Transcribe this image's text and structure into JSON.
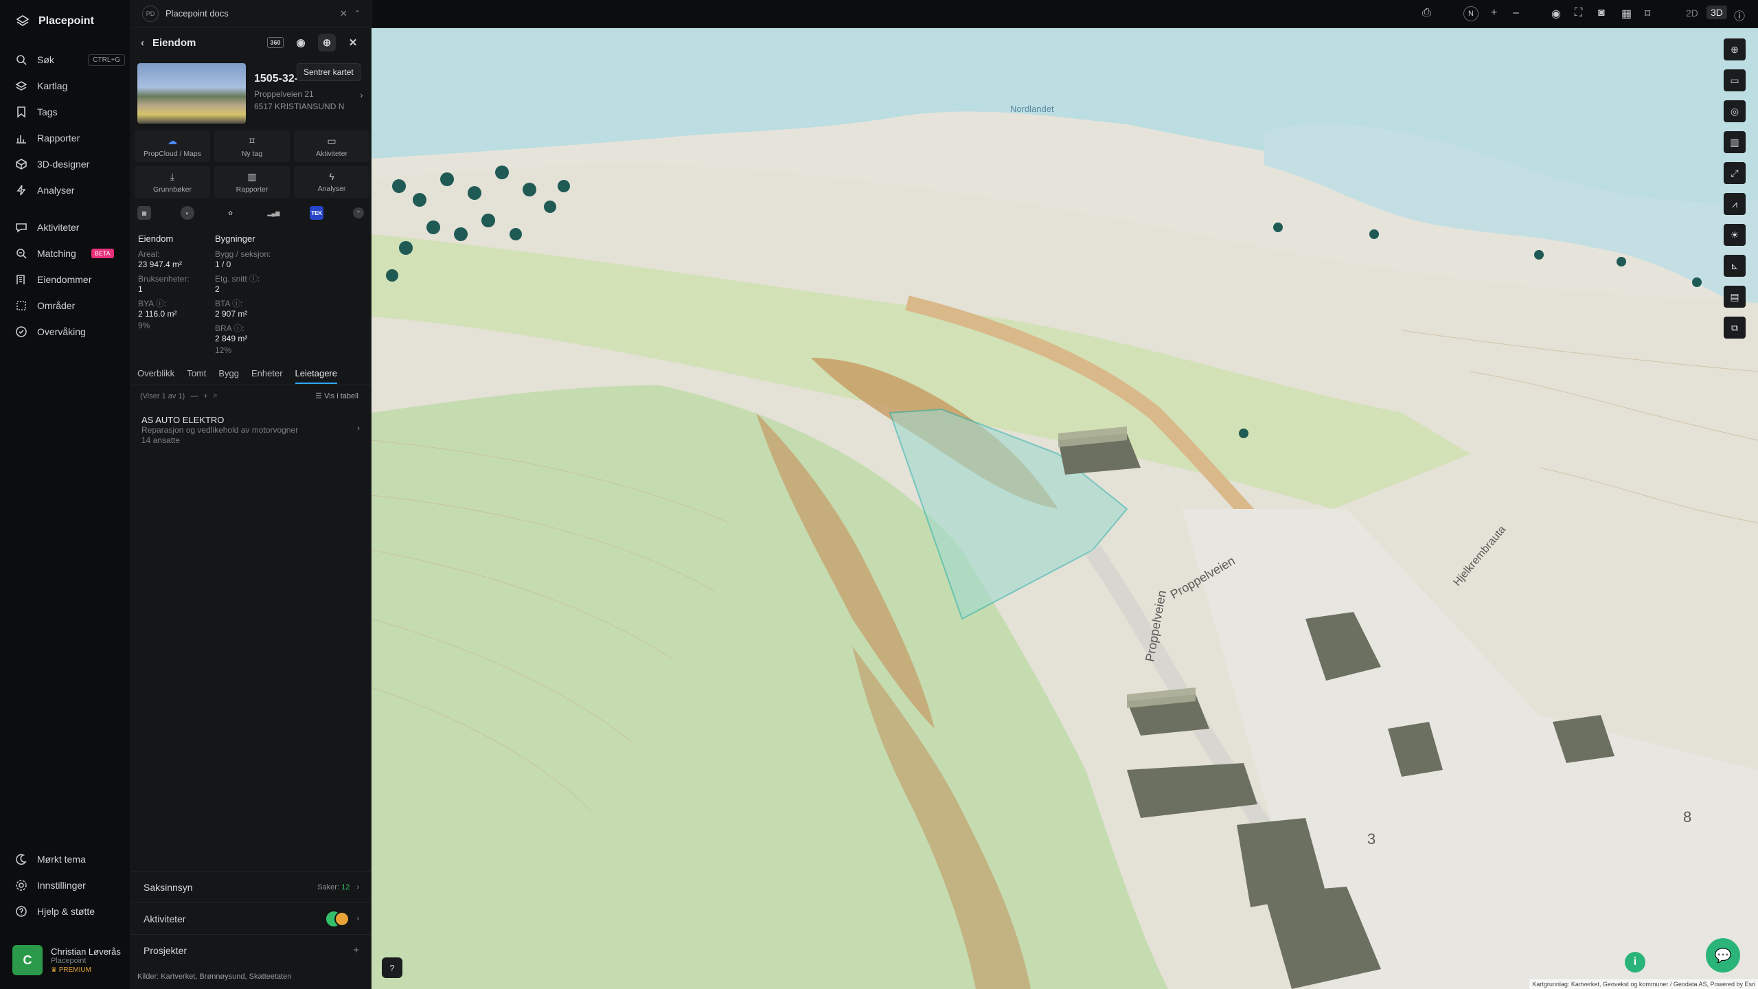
{
  "app": {
    "name": "Placepoint"
  },
  "nav": {
    "items": [
      {
        "label": "Søk",
        "shortcut": "CTRL+G"
      },
      {
        "label": "Kartlag"
      },
      {
        "label": "Tags"
      },
      {
        "label": "Rapporter"
      },
      {
        "label": "3D-designer"
      },
      {
        "label": "Analyser"
      },
      {
        "label": "Aktiviteter"
      },
      {
        "label": "Matching",
        "badge": "BETA"
      },
      {
        "label": "Eiendommer"
      },
      {
        "label": "Områder"
      },
      {
        "label": "Overvåking"
      }
    ],
    "bottom": [
      {
        "label": "Mørkt tema"
      },
      {
        "label": "Innstillinger"
      },
      {
        "label": "Hjelp & støtte"
      }
    ],
    "user": {
      "initial": "C",
      "name": "Christian Løverås",
      "org": "Placepoint",
      "plan": "PREMIUM"
    }
  },
  "doc_tab": {
    "icon_text": "PD",
    "title": "Placepoint docs"
  },
  "panel": {
    "title": "Eiendom",
    "tooltip": "Sentrer kartet",
    "property": {
      "gnr": "1505-32-",
      "address": "Proppelveien 21",
      "postal": "6517 KRISTIANSUND N"
    },
    "actions": [
      {
        "label": "PropCloud / Maps",
        "icon": "cloud-icon"
      },
      {
        "label": "Ny tag",
        "icon": "bookmark-icon"
      },
      {
        "label": "Aktiviteter",
        "icon": "chat-icon"
      },
      {
        "label": "Grunnbøker",
        "icon": "download-icon"
      },
      {
        "label": "Rapporter",
        "icon": "chart-icon"
      },
      {
        "label": "Analyser",
        "icon": "bolt-icon"
      }
    ],
    "source_tek": "TEK",
    "facts": {
      "eiendom_header": "Eiendom",
      "bygg_header": "Bygninger",
      "areal_label": "Areal:",
      "areal_value": "23 947.4 m²",
      "bruks_label": "Bruksenheter:",
      "bruks_value": "1",
      "bya_label": "BYA ⓘ:",
      "bya_value": "2 116.0 m²",
      "bya_pct": "9%",
      "bygg_label": "Bygg / seksjon:",
      "bygg_value": "1 / 0",
      "etg_label": "Etg. snitt ⓘ:",
      "etg_value": "2",
      "bta_label": "BTA ⓘ:",
      "bta_value": "2 907 m²",
      "bra_label": "BRA ⓘ:",
      "bra_value": "2 849 m²",
      "bra_pct": "12%"
    },
    "tabs": [
      "Overblikk",
      "Tomt",
      "Bygg",
      "Enheter",
      "Leietagere"
    ],
    "active_tab": "Leietagere",
    "showing": "(Viser 1 av 1)",
    "table_toggle": "Vis i tabell",
    "tenant": {
      "name": "AS AUTO ELEKTRO",
      "desc": "Reparasjon og vedlikehold av motorvogner",
      "employees": "14 ansatte"
    },
    "sections": [
      {
        "label": "Saksinnsyn",
        "meta_label": "Saker:",
        "meta_value": "12"
      },
      {
        "label": "Aktiviteter"
      },
      {
        "label": "Prosjekter"
      }
    ],
    "sources_text": "Kilder:  Kartverket,  Brønnøysund,  Skatteetaten"
  },
  "topbar": {
    "mode_2d": "2D",
    "mode_3d": "3D",
    "compass": "N"
  },
  "map": {
    "labels": {
      "road1": "Proppelveien",
      "road2": "Proppelveien",
      "road3": "Hjelkrembrauta",
      "lot_3": "3",
      "lot_8": "8",
      "water": "Nordlandet"
    },
    "attribution": "Kartgrunnlag: Kartverket, Geovekst og kommuner / Geodata AS, Powered by Esri"
  },
  "colors": {
    "accent": "#2ea8ff",
    "green": "#2bb47a",
    "beta": "#e6307a",
    "tek": "#2844c8"
  }
}
